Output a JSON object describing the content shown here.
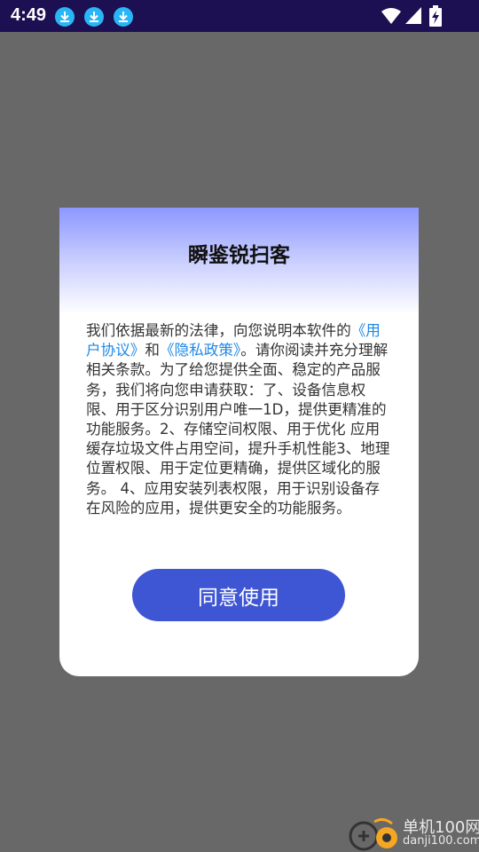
{
  "status_bar": {
    "time": "4:49",
    "notification_icons": [
      "download-icon",
      "download-icon",
      "download-icon"
    ],
    "icons": [
      "wifi-icon",
      "signal-icon",
      "battery-charging-icon"
    ]
  },
  "dialog": {
    "title": "瞬鉴锐扫客",
    "body_intro": "我们依据最新的法律，向您说明本软件的",
    "user_agreement_link": "《用户协议》",
    "and_text": "和",
    "privacy_policy_link": "《隐私政策》",
    "body_rest": "。请你阅读并充分理解相关条款。为了给您提供全面、稳定的产品服务，我们将向您申请获取：了、设备信息权限、用于区分识别用户唯一1D，提供更精准的功能服务。2、存储空间权限、用于优化 应用缓存垃圾文件占用空间，提升手机性能3、地理位置权限、用于定位更精确，提供区域化的服务。 4、应用安装列表权限，用于识别设备存在风险的应用，提供更安全的功能服务。",
    "agree_button": "同意使用"
  },
  "watermark": {
    "name": "单机100网",
    "url": "danji100.com"
  },
  "colors": {
    "status_bar": "#1c0f52",
    "overlay": "#686868",
    "button": "#3e56d4",
    "link": "#1e88e5",
    "header_gradient_top": "#8c98ff"
  }
}
